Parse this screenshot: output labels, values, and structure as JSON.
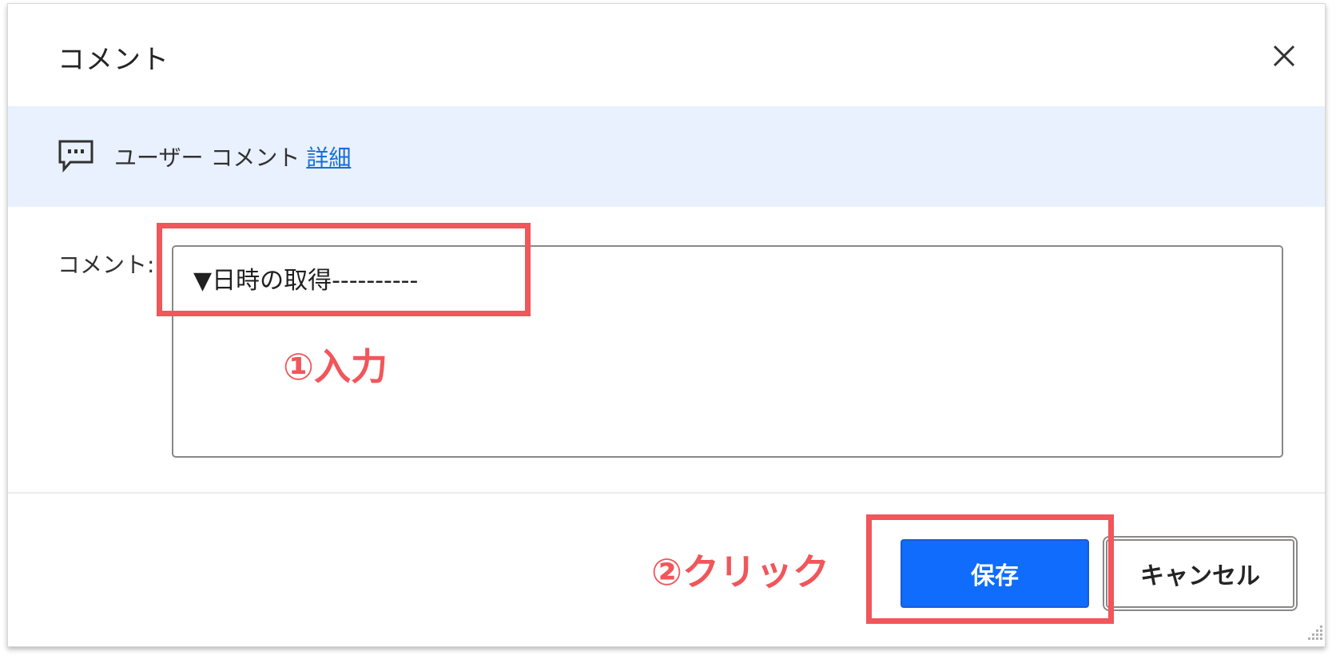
{
  "dialog": {
    "title": "コメント",
    "close_icon": "close-icon"
  },
  "info_bar": {
    "icon": "comment-icon",
    "text": "ユーザー コメント",
    "link": "詳細"
  },
  "comment_field": {
    "label": "コメント:",
    "value": "▼日時の取得----------"
  },
  "buttons": {
    "save": "保存",
    "cancel": "キャンセル"
  },
  "annotations": {
    "step1": "①入力",
    "step2": "②クリック",
    "color": "#f0565a"
  },
  "colors": {
    "primary": "#0f6cfd",
    "info_bar_bg": "#e8f1fd",
    "link": "#1a6dd5"
  }
}
